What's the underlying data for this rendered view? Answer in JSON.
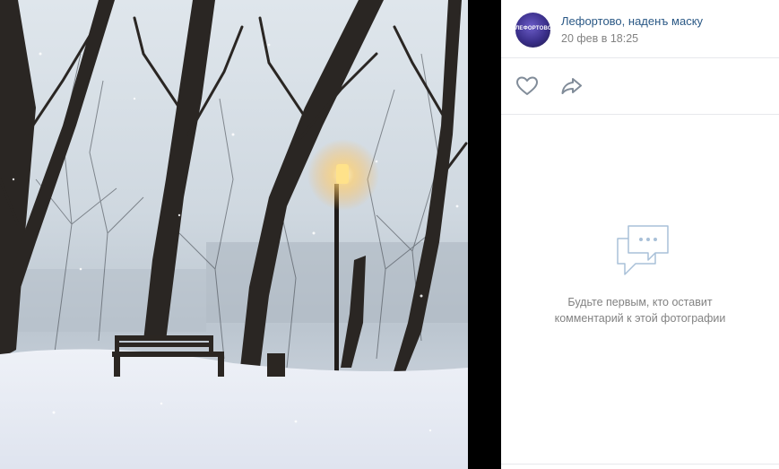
{
  "post": {
    "author": "Лефортово, наденъ маску",
    "avatar_text": "ЛЕФОРТОВО",
    "date": "20 фев в 18:25"
  },
  "actions": {
    "like_icon": "heart-icon",
    "share_icon": "share-arrow-icon"
  },
  "comments": {
    "empty_icon": "comment-bubbles-icon",
    "empty_line1": "Будьте первым, кто оставит",
    "empty_line2": "комментарий к этой фотографии"
  },
  "colors": {
    "link": "#2a5885",
    "muted": "#828282",
    "divider": "#e7e8ec",
    "icon": "#818c99"
  }
}
